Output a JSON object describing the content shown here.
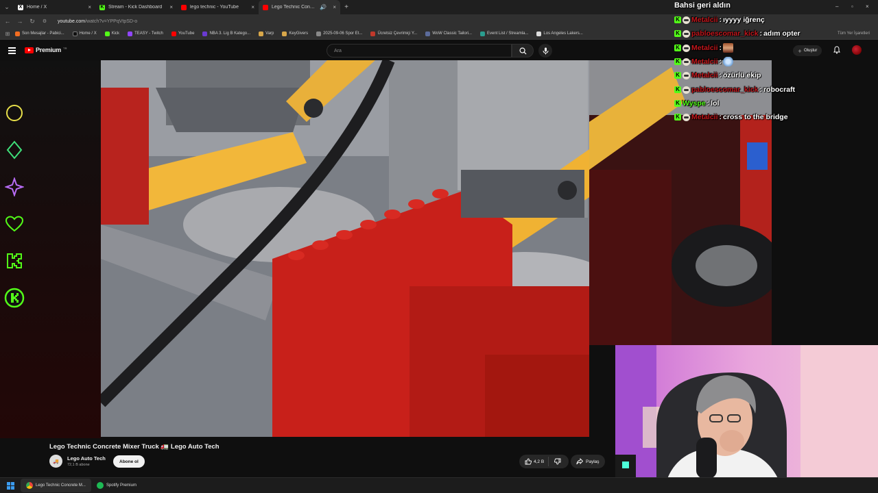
{
  "browser": {
    "tabs": [
      {
        "label": "Home / X",
        "fav_color": "#000000",
        "fav_glyph": "X",
        "active": false
      },
      {
        "label": "Stream - Kick Dashboard",
        "fav_color": "#53fc18",
        "fav_glyph": "K",
        "active": false
      },
      {
        "label": "lego technic - YouTube",
        "fav_color": "#ff0000",
        "fav_glyph": "",
        "active": false
      },
      {
        "label": "Lego Technic Concrete Mi...",
        "fav_color": "#ff0000",
        "fav_glyph": "",
        "active": true
      }
    ],
    "url_host": "youtube.com",
    "url_rest": "/watch?v=YPPqVtpSD-o",
    "bookmarks": [
      {
        "label": "Son Mesajlar - Pabici...",
        "color": "#f26d21"
      },
      {
        "label": "Home / X",
        "color": "#111111"
      },
      {
        "label": "Kick",
        "color": "#53fc18"
      },
      {
        "label": "TEASY - Twitch",
        "color": "#9146ff"
      },
      {
        "label": "YouTube",
        "color": "#ff0000"
      },
      {
        "label": "NBA 3. Lig B Katego...",
        "color": "#6a3ad1"
      },
      {
        "label": "Varp",
        "color": "#d8a74a"
      },
      {
        "label": "KeyGivers",
        "color": "#d8a74a"
      },
      {
        "label": "2025-09-06 Spor Et...",
        "color": "#888888"
      },
      {
        "label": "Ücretsiz Çevrimiçi Y...",
        "color": "#c0392b"
      },
      {
        "label": "WoW Classic Tailori...",
        "color": "#5b6b9a"
      },
      {
        "label": "Event List / Streamla...",
        "color": "#2a9d8f"
      },
      {
        "label": "Los Angeles Lakers...",
        "color": "#dddddd"
      }
    ],
    "bookmarks_right": "Tüm Yer İşaretleri"
  },
  "youtube": {
    "logo_text": "Premium",
    "logo_region": "TR",
    "search_placeholder": "Ara",
    "create_label": "Oluştur",
    "video_title": "Lego Technic Concrete Mixer Truck 🚛 Lego Auto Tech",
    "channel_name": "Lego Auto Tech",
    "channel_subs": "72,1 B abone",
    "subscribe_label": "Abone ol",
    "like_count": "4,2 B",
    "share_label": "Paylaş"
  },
  "chat": {
    "title": "Bahsi geri aldın",
    "messages": [
      {
        "user": "Metalcii",
        "color": "red",
        "badge": "shield",
        "text": "ıyyyy iğrenç",
        "emote": ""
      },
      {
        "user": "pabloescomar_kick",
        "color": "red",
        "badge": "shield",
        "text": "adım opter",
        "emote": ""
      },
      {
        "user": "Metalcii",
        "color": "red",
        "badge": "shield",
        "text": "",
        "emote": "face"
      },
      {
        "user": "Metalcii",
        "color": "red",
        "badge": "shield",
        "text": "",
        "emote": "wings"
      },
      {
        "user": "Metalcii",
        "color": "red",
        "badge": "shield",
        "text": "özürlü ekip",
        "emote": ""
      },
      {
        "user": "pabloescomar_kick",
        "color": "red",
        "badge": "shield",
        "text": "robocraft",
        "emote": ""
      },
      {
        "user": "Wyspe",
        "color": "green",
        "badge": "none",
        "text": "lol",
        "emote": ""
      },
      {
        "user": "Metalcii",
        "color": "red",
        "badge": "shield",
        "text": "cross to the bridge",
        "emote": ""
      }
    ]
  },
  "taskbar": {
    "items": [
      {
        "label": "Lego Technic Concrete M...",
        "icon_color": "#e8453c",
        "active": true
      },
      {
        "label": "Spotify Premium",
        "icon_color": "#1db954",
        "active": false
      }
    ]
  },
  "side_icons": [
    "circle-icon",
    "diamond-icon",
    "star-icon",
    "heart-icon",
    "kick-k-icon",
    "kick-circle-icon"
  ],
  "colors": {
    "accent_green": "#53fc18",
    "chat_red": "#c4161c",
    "yt_red": "#ff0000"
  }
}
